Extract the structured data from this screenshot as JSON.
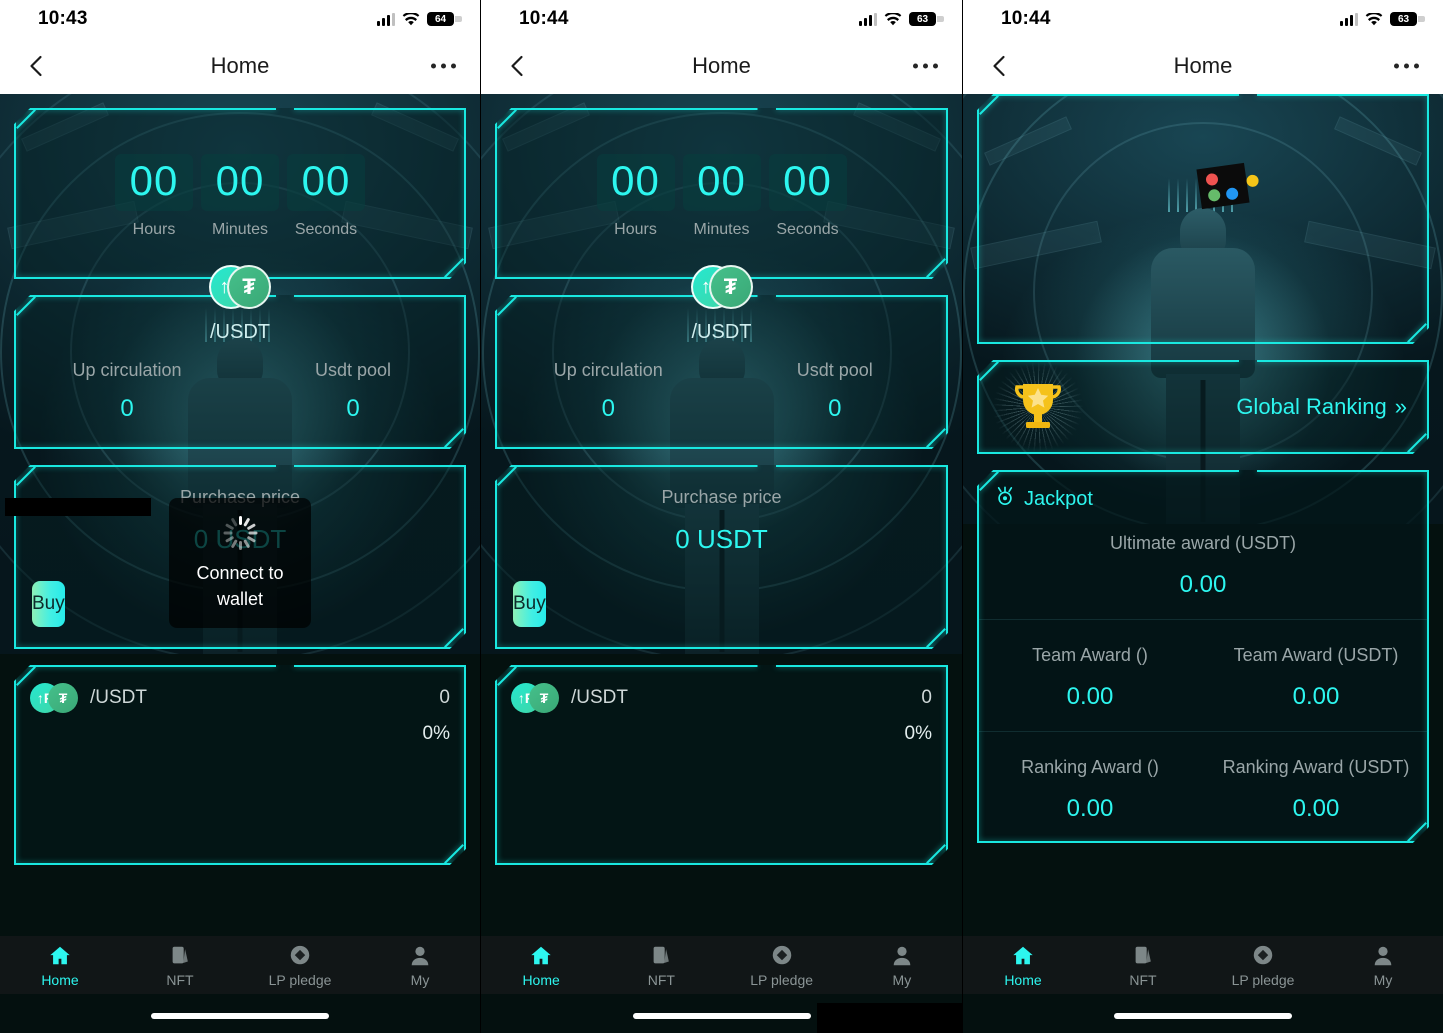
{
  "screens": [
    {
      "status": {
        "time": "10:43",
        "battery": "64",
        "signal_icon": "cellular-signal-icon",
        "wifi_icon": "wifi-icon",
        "battery_icon": "battery-icon"
      },
      "nav": {
        "title": "Home",
        "back_icon": "back-chevron-icon",
        "more_icon": "more-options-icon"
      },
      "countdown": {
        "cells": [
          {
            "value": "00",
            "label": "Hours"
          },
          {
            "value": "00",
            "label": "Minutes"
          },
          {
            "value": "00",
            "label": "Seconds"
          }
        ]
      },
      "pool": {
        "token_pair": "/USDT",
        "coin_left_icon": "up-token-icon",
        "coin_right_icon": "usdt-tether-icon",
        "stats": [
          {
            "label": "Up circulation",
            "value": "0"
          },
          {
            "label": "Usdt pool",
            "value": "0"
          }
        ]
      },
      "purchase": {
        "label": "Purchase price",
        "value": "0 USDT",
        "buy_label": "Buy"
      },
      "pair_list": [
        {
          "name": "/USDT",
          "value": "0",
          "percent": "0%"
        }
      ],
      "toast": {
        "text": "Connect to wallet",
        "spinner_icon": "loading-spinner-icon",
        "visible": true
      },
      "tabs": [
        {
          "label": "Home",
          "icon": "home-icon",
          "active": true
        },
        {
          "label": "NFT",
          "icon": "nft-cards-icon",
          "active": false
        },
        {
          "label": "LP pledge",
          "icon": "lp-diamond-icon",
          "active": false
        },
        {
          "label": "My",
          "icon": "person-icon",
          "active": false
        }
      ]
    },
    {
      "status": {
        "time": "10:44",
        "battery": "63",
        "signal_icon": "cellular-signal-icon",
        "wifi_icon": "wifi-icon",
        "battery_icon": "battery-icon"
      },
      "nav": {
        "title": "Home",
        "back_icon": "back-chevron-icon",
        "more_icon": "more-options-icon"
      },
      "countdown": {
        "cells": [
          {
            "value": "00",
            "label": "Hours"
          },
          {
            "value": "00",
            "label": "Minutes"
          },
          {
            "value": "00",
            "label": "Seconds"
          }
        ]
      },
      "pool": {
        "token_pair": "/USDT",
        "coin_left_icon": "up-token-icon",
        "coin_right_icon": "usdt-tether-icon",
        "stats": [
          {
            "label": "Up circulation",
            "value": "0"
          },
          {
            "label": "Usdt pool",
            "value": "0"
          }
        ]
      },
      "purchase": {
        "label": "Purchase price",
        "value": "0 USDT",
        "buy_label": "Buy"
      },
      "pair_list": [
        {
          "name": "/USDT",
          "value": "0",
          "percent": "0%"
        }
      ],
      "toast": {
        "text": "",
        "spinner_icon": "loading-spinner-icon",
        "visible": false
      },
      "tabs": [
        {
          "label": "Home",
          "icon": "home-icon",
          "active": true
        },
        {
          "label": "NFT",
          "icon": "nft-cards-icon",
          "active": false
        },
        {
          "label": "LP pledge",
          "icon": "lp-diamond-icon",
          "active": false
        },
        {
          "label": "My",
          "icon": "person-icon",
          "active": false
        }
      ]
    },
    {
      "status": {
        "time": "10:44",
        "battery": "63",
        "signal_icon": "cellular-signal-icon",
        "wifi_icon": "wifi-icon",
        "battery_icon": "battery-icon"
      },
      "nav": {
        "title": "Home",
        "back_icon": "back-chevron-icon",
        "more_icon": "more-options-icon"
      },
      "ranking": {
        "label": "Global Ranking",
        "chevron": "»",
        "trophy_icon": "trophy-icon"
      },
      "jackpot": {
        "title": "Jackpot",
        "icon": "jackpot-medal-icon",
        "rows": [
          [
            {
              "label": "Ultimate award (USDT)",
              "value": "0.00"
            }
          ],
          [
            {
              "label": "Team Award ()",
              "value": "0.00"
            },
            {
              "label": "Team Award (USDT)",
              "value": "0.00"
            }
          ],
          [
            {
              "label": "Ranking Award ()",
              "value": "0.00"
            },
            {
              "label": "Ranking Award (USDT)",
              "value": "0.00"
            }
          ]
        ]
      },
      "tabs": [
        {
          "label": "Home",
          "icon": "home-icon",
          "active": true
        },
        {
          "label": "NFT",
          "icon": "nft-cards-icon",
          "active": false
        },
        {
          "label": "LP pledge",
          "icon": "lp-diamond-icon",
          "active": false
        },
        {
          "label": "My",
          "icon": "person-icon",
          "active": false
        }
      ]
    }
  ],
  "theme": {
    "accent": "#2df6ef",
    "border": "#19e8e0",
    "buy_gradient_start": "#8df0b6",
    "buy_gradient_end": "#26ebeb",
    "trophy": "#f5c21b"
  }
}
